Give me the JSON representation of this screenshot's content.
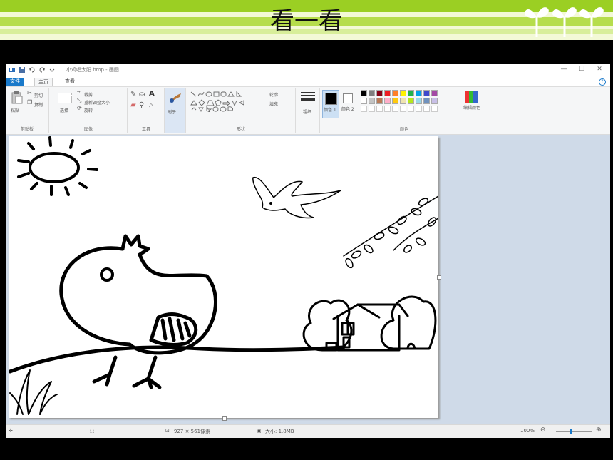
{
  "slide": {
    "title": "看一看",
    "colors": {
      "band": "#9bcf23",
      "background": "#f3f9d6"
    }
  },
  "window": {
    "title": "小鸡唱太阳.bmp - 画图",
    "controls": {
      "minimize": "—",
      "maximize": "☐",
      "close": "✕"
    }
  },
  "ribbon": {
    "tabs": {
      "file": "文件",
      "home": "主页",
      "view": "查看"
    },
    "clipboard": {
      "paste": "粘贴",
      "cut": "剪切",
      "copy": "复制",
      "label": "剪贴板"
    },
    "image": {
      "select": "选择",
      "crop": "裁剪",
      "resize": "重新调整大小",
      "rotate": "旋转",
      "label": "图像"
    },
    "tools": {
      "label": "工具",
      "text_tool": "A"
    },
    "brushes": {
      "label": "刷子"
    },
    "shapes": {
      "outline": "轮廓",
      "fill": "填充",
      "label": "形状"
    },
    "size": {
      "label": "粗细"
    },
    "colors": {
      "color1": "颜色 1",
      "color2": "颜色 2",
      "edit": "编辑颜色",
      "label": "颜色",
      "palette": [
        "#000000",
        "#7f7f7f",
        "#880015",
        "#ed1c24",
        "#ff7f27",
        "#fff200",
        "#22b14c",
        "#00a2e8",
        "#3f48cc",
        "#a349a4",
        "#ffffff",
        "#c3c3c3",
        "#b97a57",
        "#ffaec9",
        "#ffc90e",
        "#efe4b0",
        "#b5e61d",
        "#99d9ea",
        "#7092be",
        "#c8bfe7"
      ]
    }
  },
  "status": {
    "dimensions": "927 × 561像素",
    "filesize": "大小: 1.8MB",
    "zoom": "100%"
  }
}
